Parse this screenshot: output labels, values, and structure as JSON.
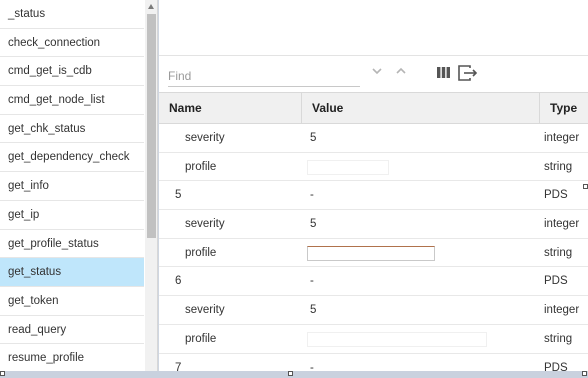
{
  "commands": [
    {
      "label": "_status"
    },
    {
      "label": "check_connection"
    },
    {
      "label": "cmd_get_is_cdb"
    },
    {
      "label": "cmd_get_node_list"
    },
    {
      "label": "get_chk_status"
    },
    {
      "label": "get_dependency_check"
    },
    {
      "label": "get_info"
    },
    {
      "label": "get_ip"
    },
    {
      "label": "get_profile_status"
    },
    {
      "label": "get_status",
      "selected": true
    },
    {
      "label": "get_token"
    },
    {
      "label": "read_query"
    },
    {
      "label": "resume_profile"
    }
  ],
  "toolbar": {
    "find_placeholder": "Find",
    "icons": [
      "chevron-down-icon",
      "chevron-up-icon",
      "columns-icon",
      "export-icon"
    ]
  },
  "grid": {
    "headers": {
      "name": "Name",
      "value": "Value",
      "type": "Type"
    },
    "rows": [
      {
        "name": "severity",
        "value": "5",
        "type": "integer",
        "child": true
      },
      {
        "name": "profile",
        "value": "",
        "type": "string",
        "child": true,
        "field": "small"
      },
      {
        "name": "5",
        "value": "-",
        "type": "PDS",
        "child": false
      },
      {
        "name": "severity",
        "value": "5",
        "type": "integer",
        "child": true
      },
      {
        "name": "profile",
        "value": "",
        "type": "string",
        "child": true,
        "field": "active"
      },
      {
        "name": "6",
        "value": "-",
        "type": "PDS",
        "child": false
      },
      {
        "name": "severity",
        "value": "5",
        "type": "integer",
        "child": true
      },
      {
        "name": "profile",
        "value": "",
        "type": "string",
        "child": true,
        "field": "wide"
      },
      {
        "name": "7",
        "value": "-",
        "type": "PDS",
        "child": false
      }
    ]
  },
  "colors": {
    "selected_row": "#bfe6fb",
    "header_bg": "#f0f0f0",
    "active_field_border": "#b0724c"
  }
}
